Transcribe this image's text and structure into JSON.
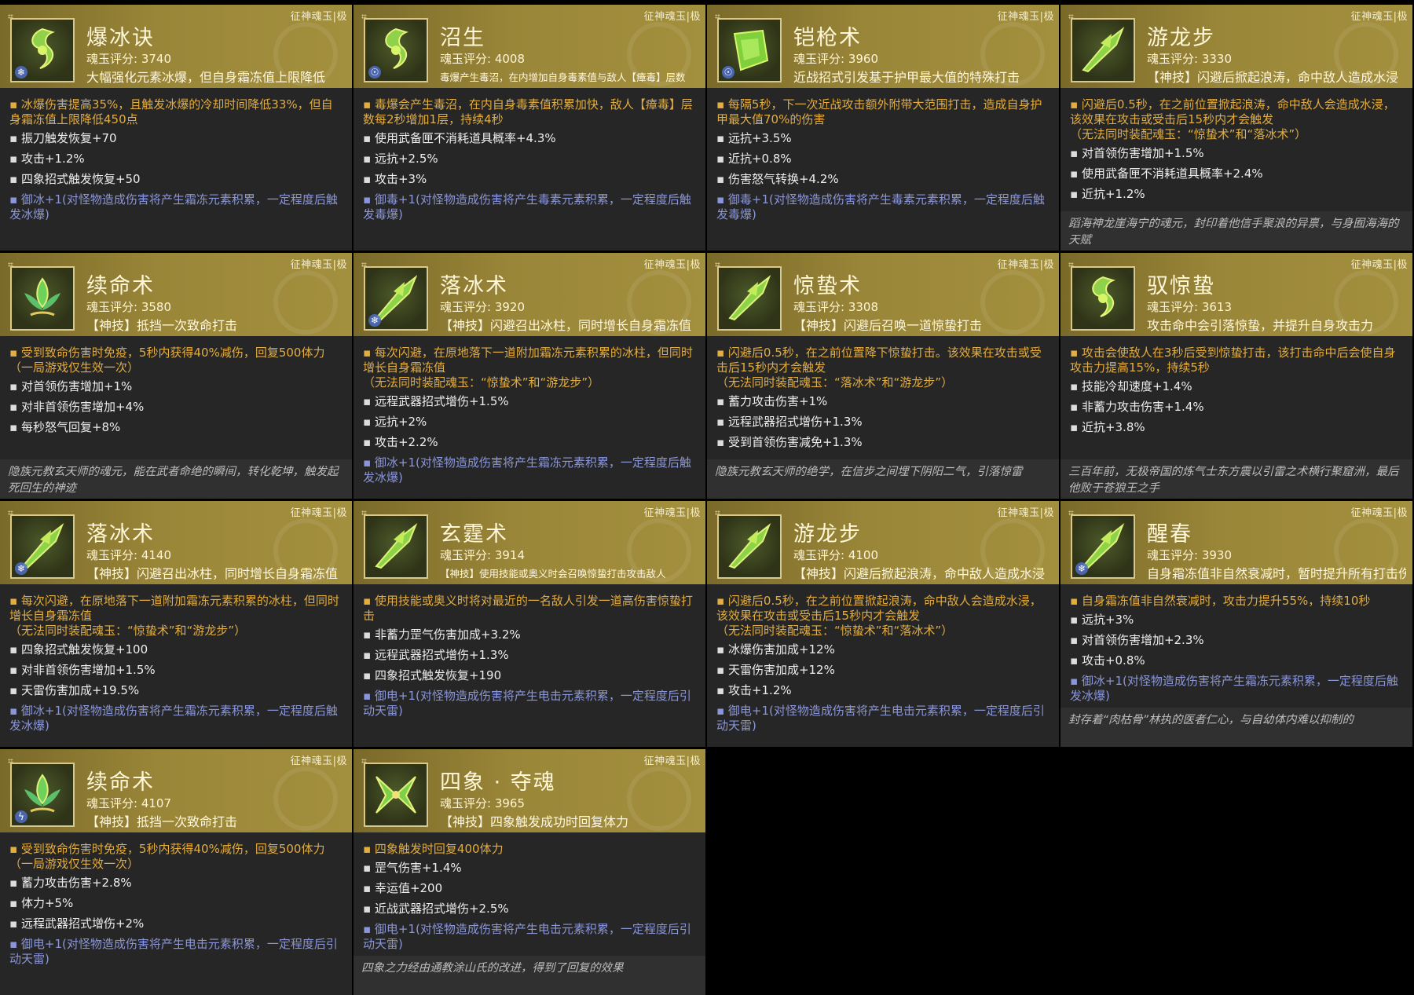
{
  "cards": [
    {
      "tag": "征神魂玉|极",
      "icon": "serpent-jade-icon",
      "badge": "❄",
      "name": "爆冰诀",
      "score": "魂玉评分: 3740",
      "desc": "大幅强化元素冰爆，但自身霜冻值上限降低",
      "main": "▪ 冰爆伤害提高35%，且触发冰爆的冷却时间降低33%，但自身霜冻值上限降低450点",
      "stats": [
        "振刀触发恢复+70",
        "攻击+1.2%",
        "四象招式触发恢复+50"
      ],
      "element": "▪ 御冰+1(对怪物造成伤害将产生霜冻元素积累，一定程度后触发冰爆)",
      "lore": ""
    },
    {
      "tag": "征神魂玉|极",
      "icon": "serpent-jade-icon",
      "badge": "☉",
      "name": "沼生",
      "score": "魂玉评分: 4008",
      "desc": "毒爆产生毒沼，在内增加自身毒素值与敌人【瘴毒】层数",
      "main": "▪ 毒爆会产生毒沼，在内自身毒素值积累加快，敌人【瘴毒】层数每2秒增加1层，持续4秒",
      "stats": [
        "使用武备匣不消耗道具概率+4.3%",
        "远抗+2.5%",
        "攻击+3%"
      ],
      "element": "▪ 御毒+1(对怪物造成伤害将产生毒素元素积累，一定程度后触发毒爆)",
      "lore": ""
    },
    {
      "tag": "征神魂玉|极",
      "icon": "jade-block-icon",
      "badge": "☉",
      "name": "铠枪术",
      "score": "魂玉评分: 3960",
      "desc": "近战招式引发基于护甲最大值的特殊打击",
      "main": "▪ 每隔5秒，下一次近战攻击额外附带大范围打击，造成自身护甲最大值70%的伤害",
      "stats": [
        "远抗+3.5%",
        "近抗+0.8%",
        "伤害怒气转换+4.2%"
      ],
      "element": "▪ 御毒+1(对怪物造成伤害将产生毒素元素积累，一定程度后触发毒爆)",
      "lore": ""
    },
    {
      "tag": "征神魂玉|极",
      "icon": "dragon-blade-icon",
      "badge": "",
      "name": "游龙步",
      "score": "魂玉评分: 3330",
      "desc": "【神技】闪避后掀起浪涛，命中敌人造成水浸",
      "main": "▪ 闪避后0.5秒，在之前位置掀起浪涛，命中敌人会造成水浸，该效果在攻击或受击后15秒内才会触发\n（无法同时装配魂玉：“惊蛰术”和“落冰术”）",
      "stats": [
        "对首领伤害增加+1.5%",
        "使用武备匣不消耗道具概率+2.4%",
        "近抗+1.2%"
      ],
      "element": "",
      "lore": "蹈海神龙崖海宁的魂元，封印着他信手聚浪的异禀，与身囿海海的天赋"
    },
    {
      "tag": "征神魂玉|极",
      "icon": "lotus-jade-icon",
      "badge": "",
      "name": "续命术",
      "score": "魂玉评分: 3580",
      "desc": "【神技】抵挡一次致命打击",
      "main": "▪ 受到致命伤害时免疫，5秒内获得40%减伤，回复500体力\n（一局游戏仅生效一次）",
      "stats": [
        "对首领伤害增加+1%",
        "对非首领伤害增加+4%",
        "每秒怒气回复+8%"
      ],
      "element": "",
      "lore": "隐族元教玄天师的魂元，能在武者命绝的瞬间，转化乾坤，触发起死回生的神迹"
    },
    {
      "tag": "征神魂玉|极",
      "icon": "dragon-blade-icon",
      "badge": "❄",
      "name": "落冰术",
      "score": "魂玉评分: 3920",
      "desc": "【神技】闪避召出冰柱，同时增长自身霜冻值",
      "main": "▪ 每次闪避，在原地落下一道附加霜冻元素积累的冰柱，但同时增长自身霜冻值\n（无法同时装配魂玉：“惊蛰术”和“游龙步”）",
      "stats": [
        "远程武器招式增伤+1.5%",
        "远抗+2%",
        "攻击+2.2%"
      ],
      "element": "▪ 御冰+1(对怪物造成伤害将产生霜冻元素积累，一定程度后触发冰爆)",
      "lore": ""
    },
    {
      "tag": "征神魂玉|极",
      "icon": "dragon-blade-icon",
      "badge": "",
      "name": "惊蛰术",
      "score": "魂玉评分: 3308",
      "desc": "【神技】闪避后召唤一道惊蛰打击",
      "main": "▪ 闪避后0.5秒，在之前位置降下惊蛰打击。该效果在攻击或受击后15秒内才会触发\n（无法同时装配魂玉：“落冰术”和“游龙步”）",
      "stats": [
        "蓄力攻击伤害+1%",
        "远程武器招式增伤+1.3%",
        "受到首领伤害减免+1.3%"
      ],
      "element": "",
      "lore": "隐族元教玄天师的绝学，在信步之间埋下阴阳二气，引落惊雷"
    },
    {
      "tag": "征神魂玉|极",
      "icon": "serpent-jade-icon",
      "badge": "",
      "name": "驭惊蛰",
      "score": "魂玉评分: 3613",
      "desc": "攻击命中会引落惊蛰，并提升自身攻击力",
      "main": "▪ 攻击会使敌人在3秒后受到惊蛰打击，该打击命中后会使自身攻击力提高15%，持续5秒",
      "stats": [
        "技能冷却速度+1.4%",
        "非蓄力攻击伤害+1.4%",
        "近抗+3.8%"
      ],
      "element": "",
      "lore": "三百年前，无极帝国的炼气士东方震以引雷之术横行聚窟洲，最后他败于苍狼王之手"
    },
    {
      "tag": "征神魂玉|极",
      "icon": "dragon-blade-icon",
      "badge": "❄",
      "name": "落冰术",
      "score": "魂玉评分: 4140",
      "desc": "【神技】闪避召出冰柱，同时增长自身霜冻值",
      "main": "▪ 每次闪避，在原地落下一道附加霜冻元素积累的冰柱，但同时增长自身霜冻值\n（无法同时装配魂玉：“惊蛰术”和“游龙步”）",
      "stats": [
        "四象招式触发恢复+100",
        "对非首领伤害增加+1.5%",
        "天雷伤害加成+19.5%"
      ],
      "element": "▪ 御冰+1(对怪物造成伤害将产生霜冻元素积累，一定程度后触发冰爆)",
      "lore": ""
    },
    {
      "tag": "征神魂玉|极",
      "icon": "dragon-blade-icon",
      "badge": "",
      "name": "玄霆术",
      "score": "魂玉评分: 3914",
      "desc": "【神技】使用技能或奥义时会召唤惊蛰打击攻击敌人",
      "main": "▪ 使用技能或奥义时将对最近的一名敌人引发一道高伤害惊蛰打击",
      "stats": [
        "非蓄力罡气伤害加成+3.2%",
        "远程武器招式增伤+1.3%",
        "四象招式触发恢复+190"
      ],
      "element": "▪ 御电+1(对怪物造成伤害将产生电击元素积累，一定程度后引动天雷)",
      "lore": ""
    },
    {
      "tag": "征神魂玉|极",
      "icon": "dragon-blade-icon",
      "badge": "",
      "name": "游龙步",
      "score": "魂玉评分: 4100",
      "desc": "【神技】闪避后掀起浪涛，命中敌人造成水浸",
      "main": "▪ 闪避后0.5秒，在之前位置掀起浪涛，命中敌人会造成水浸，该效果在攻击或受击后15秒内才会触发\n（无法同时装配魂玉：“惊蛰术”和“落冰术”）",
      "stats": [
        "冰爆伤害加成+12%",
        "天雷伤害加成+12%",
        "攻击+1.2%"
      ],
      "element": "▪ 御电+1(对怪物造成伤害将产生电击元素积累，一定程度后引动天雷)",
      "lore": ""
    },
    {
      "tag": "征神魂玉|极",
      "icon": "dragon-blade-icon",
      "badge": "❄",
      "name": "醒春",
      "score": "魂玉评分: 3930",
      "desc": "自身霜冻值非自然衰减时，暂时提升所有打击伤害",
      "main": "▪ 自身霜冻值非自然衰减时，攻击力提升55%，持续10秒",
      "stats": [
        "远抗+3%",
        "对首领伤害增加+2.3%",
        "攻击+0.8%"
      ],
      "element": "▪ 御冰+1(对怪物造成伤害将产生霜冻元素积累，一定程度后触发冰爆)",
      "lore": "封存着“肉枯骨”林执的医者仁心，与自幼体内难以抑制的"
    },
    {
      "tag": "征神魂玉|极",
      "icon": "lotus-jade-icon",
      "badge": "ϟ",
      "name": "续命术",
      "score": "魂玉评分: 4107",
      "desc": "【神技】抵挡一次致命打击",
      "main": "▪ 受到致命伤害时免疫，5秒内获得40%减伤，回复500体力\n（一局游戏仅生效一次）",
      "stats": [
        "蓄力攻击伤害+2.8%",
        "体力+5%",
        "远程武器招式增伤+2%"
      ],
      "element": "▪ 御电+1(对怪物造成伤害将产生电击元素积累，一定程度后引动天雷)",
      "lore": ""
    },
    {
      "tag": "征神魂玉|极",
      "icon": "butterfly-jade-icon",
      "badge": "",
      "name": "四象 · 夺魂",
      "score": "魂玉评分: 3965",
      "desc": "【神技】四象触发成功时回复体力",
      "main": "▪ 四象触发时回复400体力",
      "stats": [
        "罡气伤害+1.4%",
        "幸运值+200",
        "近战武器招式增伤+2.5%"
      ],
      "element": "▪ 御电+1(对怪物造成伤害将产生电击元素积累，一定程度后引动天雷)",
      "lore": "四象之力经由通教涂山氏的改进，得到了回复的效果"
    }
  ]
}
